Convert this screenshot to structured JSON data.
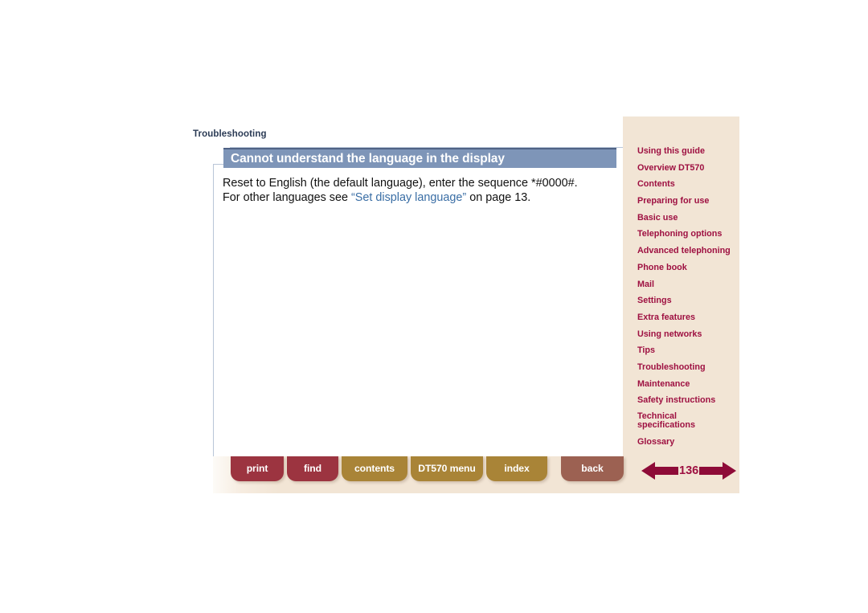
{
  "document": {
    "breadcrumb": "Troubleshooting",
    "heading": "Cannot understand the language in the display",
    "body": {
      "line1": "Reset to English (the default language), enter the sequence *#0000#.",
      "line2_before": "For other languages see ",
      "line2_link": "“Set display language”",
      "line2_after": " on page 13."
    }
  },
  "sidebar": {
    "items": [
      {
        "label": "Using this guide"
      },
      {
        "label": "Overview DT570"
      },
      {
        "label": "Contents"
      },
      {
        "label": "Preparing for use"
      },
      {
        "label": "Basic use"
      },
      {
        "label": "Telephoning options"
      },
      {
        "label": "Advanced telephoning"
      },
      {
        "label": "Phone book"
      },
      {
        "label": "Mail"
      },
      {
        "label": "Settings"
      },
      {
        "label": "Extra features"
      },
      {
        "label": "Using networks"
      },
      {
        "label": "Tips"
      },
      {
        "label": "Troubleshooting"
      },
      {
        "label": "Maintenance"
      },
      {
        "label": "Safety instructions"
      },
      {
        "label": "Technical specifications"
      },
      {
        "label": "Glossary"
      }
    ]
  },
  "toolbar": {
    "print_label": "print",
    "find_label": "find",
    "contents_label": "contents",
    "dt570_menu_label": "DT570 menu",
    "index_label": "index",
    "back_label": "back"
  },
  "pager": {
    "page_number": "136",
    "prev_icon": "arrow-left-icon",
    "next_icon": "arrow-right-icon"
  },
  "colors": {
    "heading_bar": "#7e95b8",
    "heading_bar_top": "#4f6285",
    "sidebar_bg": "#f2e5d5",
    "sidebar_link": "#9e1041",
    "tab_red": "#9c3440",
    "tab_gold": "#a98437",
    "tab_back": "#9c6152",
    "link_blue": "#3a6ea5",
    "breadcrumb": "#2b3b55"
  }
}
